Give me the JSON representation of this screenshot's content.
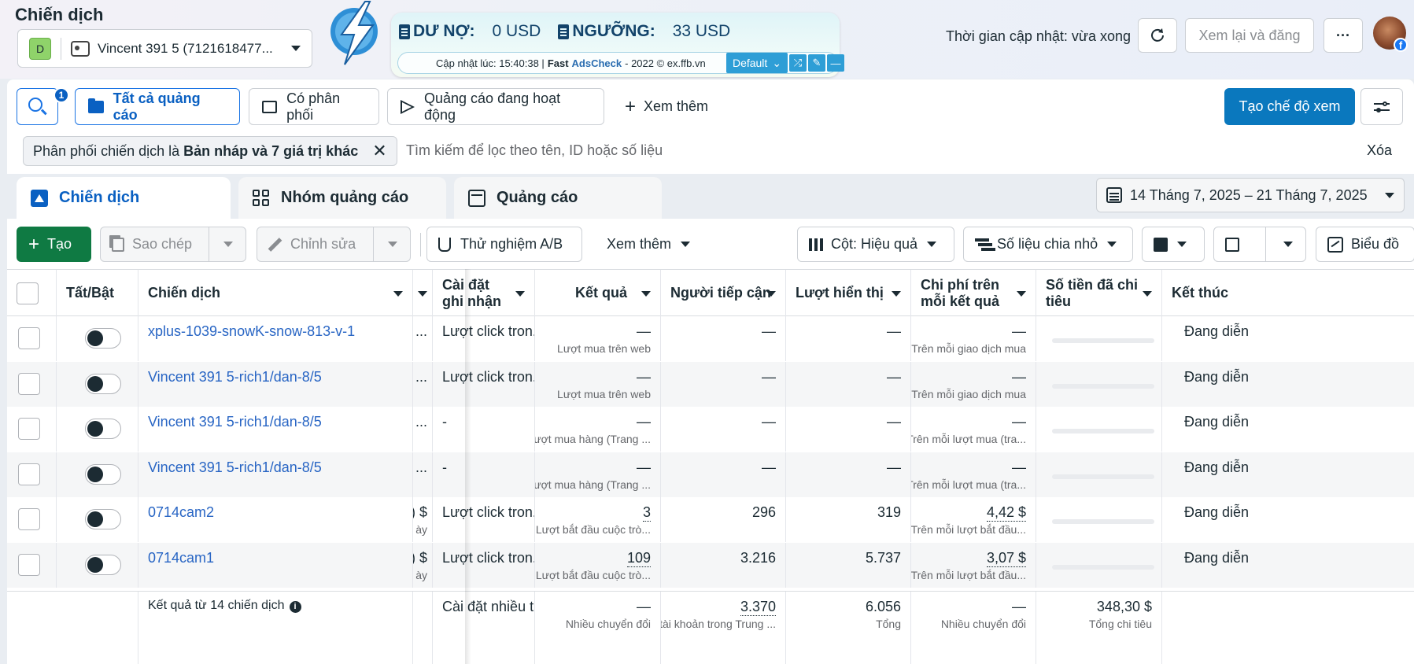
{
  "header": {
    "page_title": "Chiến dịch",
    "account_badge": "D",
    "account_name": "Vincent 391 5 (7121618477...",
    "update_time": "Thời gian cập nhật: vừa xong",
    "review_publish": "Xem lại và đăng",
    "more": "···"
  },
  "fad": {
    "debt_label": "DƯ NỢ:",
    "debt_value": "0 USD",
    "threshold_label": "NGƯỠNG:",
    "threshold_value": "33 USD",
    "updated_at": "Cập nhật lúc: 15:40:38 |",
    "brand_fast": "Fast",
    "brand_ads": "AdsCheck",
    "copyright": "- 2022 © ex.ffb.vn",
    "profile_select": "Default"
  },
  "filterbar": {
    "search_count": "1",
    "all_ads": "Tất cả quảng cáo",
    "delivered": "Có phân phối",
    "active_ads": "Quảng cáo đang hoạt động",
    "see_more": "Xem thêm",
    "create_view": "Tạo chế độ xem"
  },
  "search": {
    "chip_prefix": "Phân phối chiến dịch là",
    "chip_value": "Bản nháp và 7 giá trị khác",
    "placeholder": "Tìm kiếm để lọc theo tên, ID hoặc số liệu",
    "clear": "Xóa"
  },
  "tabs": {
    "campaigns": "Chiến dịch",
    "adsets": "Nhóm quảng cáo",
    "ads": "Quảng cáo",
    "date_range": "14 Tháng 7, 2025 – 21 Tháng 7, 2025"
  },
  "toolbar": {
    "create": "Tạo",
    "duplicate": "Sao chép",
    "edit": "Chỉnh sửa",
    "ab_test": "Thử nghiệm A/B",
    "see_more": "Xem thêm",
    "columns": "Cột: Hiệu quả",
    "breakdown": "Số liệu chia nhỏ",
    "chart": "Biểu đồ"
  },
  "table": {
    "headers": {
      "toggle": "Tất/Bật",
      "campaign": "Chiến dịch",
      "attribution": "Cài đặt ghi nhận",
      "results": "Kết quả",
      "reach": "Người tiếp cận",
      "impressions": "Lượt hiển thị",
      "cost_per_result": "Chi phí trên mỗi kết quả",
      "amount_spent": "Số tiền đã chi tiêu",
      "ends": "Kết thúc"
    },
    "rows": [
      {
        "name": "xplus-1039-snowK-snow-813-v-1",
        "budget": "...",
        "budget_sub": "",
        "attribution": "Lượt click tron...",
        "result": "—",
        "result_sub": "Lượt mua trên web",
        "reach": "—",
        "impressions": "—",
        "cpr": "—",
        "cpr_sub": "Trên mỗi giao dịch mua",
        "ends": "Đang diễn"
      },
      {
        "name": "Vincent 391 5-rich1/dan-8/5",
        "budget": "...",
        "budget_sub": "",
        "attribution": "Lượt click tron...",
        "result": "—",
        "result_sub": "Lượt mua trên web",
        "reach": "—",
        "impressions": "—",
        "cpr": "—",
        "cpr_sub": "Trên mỗi giao dịch mua",
        "ends": "Đang diễn"
      },
      {
        "name": "Vincent 391 5-rich1/dan-8/5",
        "budget": "...",
        "budget_sub": "",
        "attribution": "-",
        "result": "—",
        "result_sub": "Lượt mua hàng (Trang ...",
        "reach": "—",
        "impressions": "—",
        "cpr": "—",
        "cpr_sub": "Trên mỗi lượt mua (tra...",
        "ends": "Đang diễn"
      },
      {
        "name": "Vincent 391 5-rich1/dan-8/5",
        "budget": "...",
        "budget_sub": "",
        "attribution": "-",
        "result": "—",
        "result_sub": "Lượt mua hàng (Trang ...",
        "reach": "—",
        "impressions": "—",
        "cpr": "—",
        "cpr_sub": "Trên mỗi lượt mua (tra...",
        "ends": "Đang diễn"
      },
      {
        "name": "0714cam2",
        "budget": ") $",
        "budget_sub": "ày",
        "attribution": "Lượt click tron...",
        "result": "3",
        "result_sub": "Lượt bắt đầu cuộc trò...",
        "reach": "296",
        "impressions": "319",
        "cpr": "4,42 $",
        "cpr_sub": "Trên mỗi lượt bắt đầu...",
        "ends": "Đang diễn"
      },
      {
        "name": "0714cam1",
        "budget": ") $",
        "budget_sub": "ày",
        "attribution": "Lượt click tron...",
        "result": "109",
        "result_sub": "Lượt bắt đầu cuộc trò...",
        "reach": "3.216",
        "impressions": "5.737",
        "cpr": "3,07 $",
        "cpr_sub": "Trên mỗi lượt bắt đầu...",
        "ends": "Đang diễn"
      }
    ],
    "footer": {
      "summary": "Kết quả từ 14 chiến dịch",
      "attribution": "Cài đặt nhiều t...",
      "result": "—",
      "result_sub": "Nhiều chuyển đổi",
      "reach": "3.370",
      "reach_sub": "tài khoản trong Trung ...",
      "impressions": "6.056",
      "impressions_sub": "Tổng",
      "cpr": "—",
      "cpr_sub": "Nhiều chuyển đổi",
      "spent": "348,30 $",
      "spent_sub": "Tổng chi tiêu"
    }
  },
  "colors": {
    "primary": "#0a78be",
    "link": "#2865c4",
    "create_green": "#0f7a43",
    "active_tab": "#0a60c2"
  }
}
